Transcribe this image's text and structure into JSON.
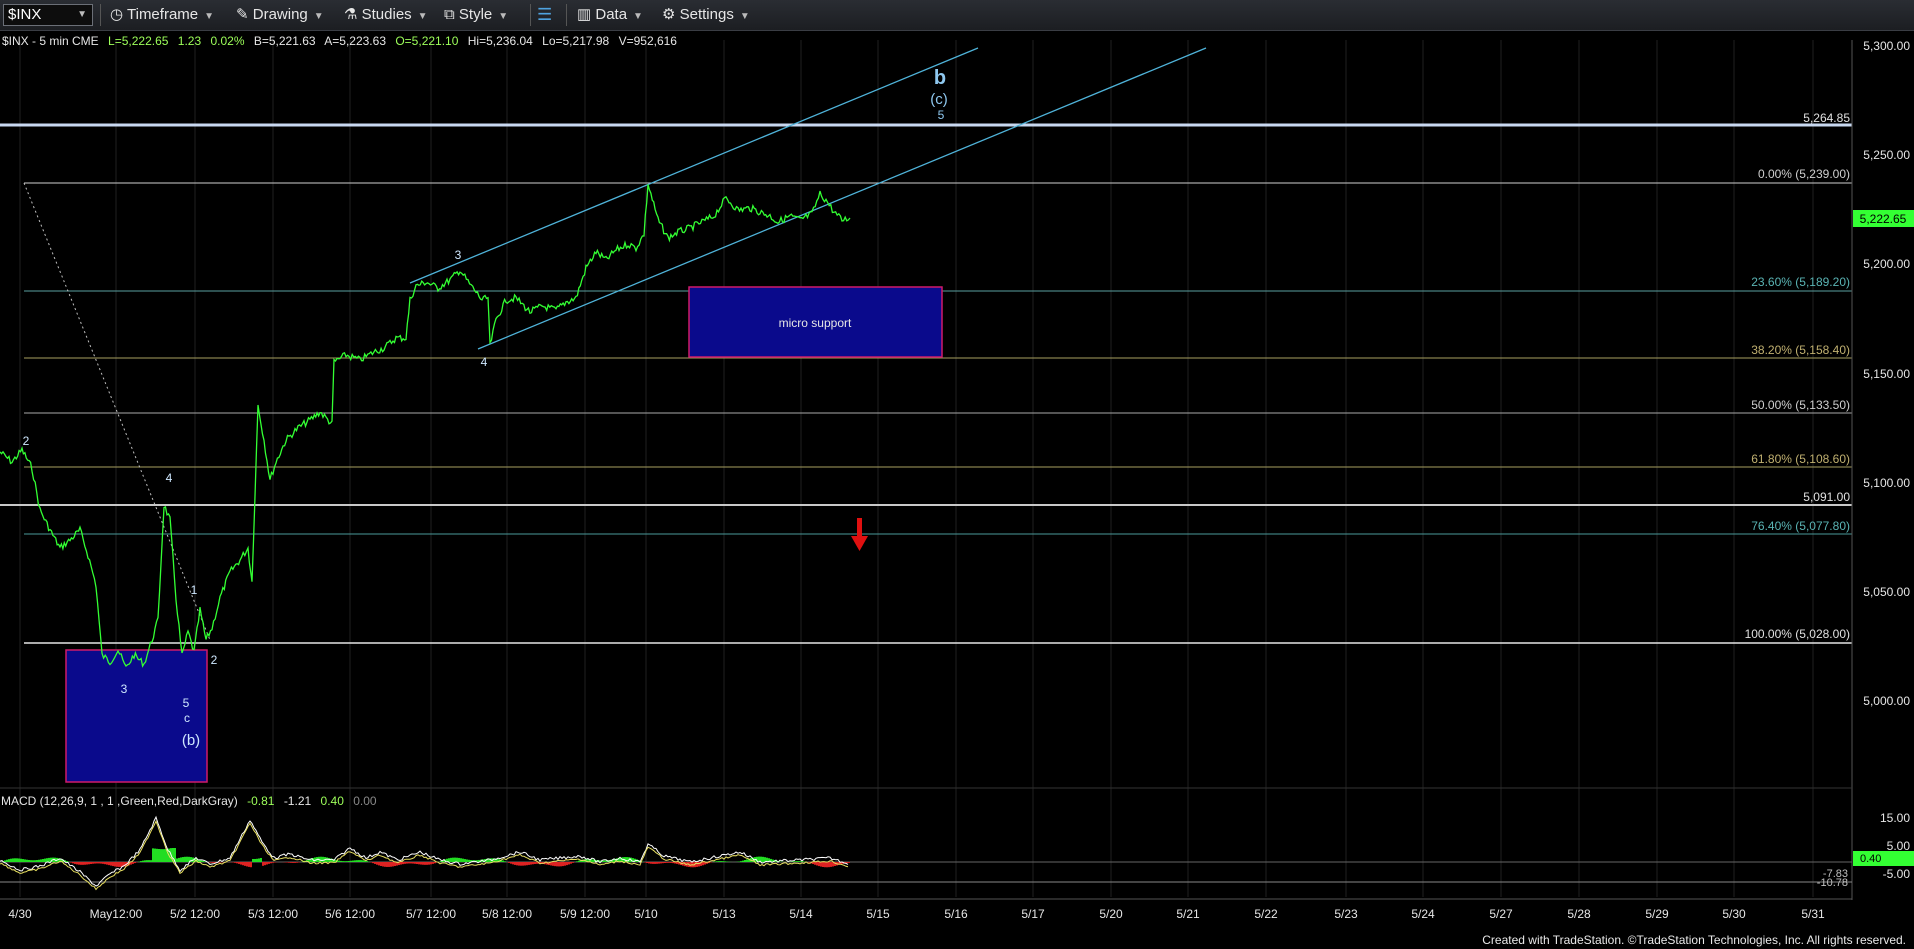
{
  "toolbar": {
    "symbol": "$INX",
    "timeframe": "Timeframe",
    "drawing": "Drawing",
    "studies": "Studies",
    "style": "Style",
    "data": "Data",
    "settings": "Settings"
  },
  "info_bar": {
    "symbol_desc": "$INX - 5 min  CME",
    "last": "L=5,222.65",
    "change": "1.23",
    "change_pct": "0.02%",
    "bid": "B=5,221.63",
    "ask": "A=5,223.63",
    "open": "O=5,221.10",
    "high": "Hi=5,236.04",
    "low": "Lo=5,217.98",
    "volume": "V=952,616"
  },
  "macd": {
    "label": "MACD (12,26,9, 1 , 1 ,Green,Red,DarkGray)",
    "v1": "-0.81",
    "v2": "-1.21",
    "v3": "0.40",
    "v4": "0.00",
    "axis": [
      "15.00",
      "5.00",
      "-5.00"
    ],
    "val_green": "0.40",
    "val_a": "-7.83",
    "val_b": "-10.78"
  },
  "price_axis": [
    "5,300.00",
    "5,250.00",
    "5,200.00",
    "5,150.00",
    "5,100.00",
    "5,050.00",
    "5,000.00"
  ],
  "current_price": "5,222.65",
  "date_axis": [
    "4/30",
    "May12:00",
    "5/2 12:00",
    "5/3 12:00",
    "5/6 12:00",
    "5/7 12:00",
    "5/8 12:00",
    "5/9 12:00",
    "5/10",
    "5/13",
    "5/14",
    "5/15",
    "5/16",
    "5/17",
    "5/20",
    "5/21",
    "5/22",
    "5/23",
    "5/24",
    "5/27",
    "5/28",
    "5/29",
    "5/30",
    "5/31"
  ],
  "levels": {
    "l_5264": "5,264.85",
    "fib_0": "0.00% (5,239.00)",
    "fib_236": "23.60% (5,189.20)",
    "fib_382": "38.20% (5,158.40)",
    "fib_50": "50.00% (5,133.50)",
    "fib_618": "61.80% (5,108.60)",
    "l_5091": "5,091.00",
    "fib_764": "76.40% (5,077.80)",
    "fib_100": "100.00% (5,028.00)"
  },
  "annotations": {
    "micro_support": "micro support",
    "wave_b": "b",
    "wave_c_paren": "(c)",
    "wave_5_top": "5",
    "wave_3_mid": "3",
    "wave_4_mid": "4",
    "wave_2_left": "2",
    "wave_4_left": "4",
    "wave_1_left": "1",
    "wave_2_low": "2",
    "wave_3_low": "3",
    "wave_5_low": "5",
    "wave_c_low": "c",
    "wave_b_paren": "(b)"
  },
  "colors": {
    "background": "#000000",
    "price_line": "#33ff33",
    "channel": "#4fb3d9",
    "support_box": "#0a0a8c",
    "box_border": "#d01a6a",
    "arrow": "#e01010"
  },
  "footer": "Created with TradeStation. ©TradeStation Technologies, Inc. All rights reserved."
}
